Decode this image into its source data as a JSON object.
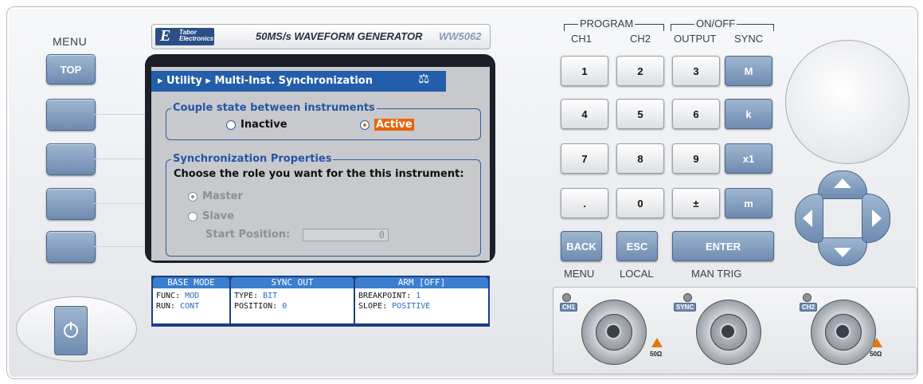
{
  "menu": {
    "label": "MENU",
    "top_button": "TOP"
  },
  "header": {
    "brand_short": "Tabor",
    "brand_line2": "Electronics",
    "title": "50MS/s WAVEFORM GENERATOR",
    "model": "WW5062"
  },
  "screen": {
    "breadcrumb": "▸ Utility ▸ Multi-Inst. Synchronization",
    "couple_group": {
      "title": "Couple state between instruments",
      "inactive": "Inactive",
      "active": "Active"
    },
    "sync_group": {
      "title": "Synchronization Properties",
      "prompt": "Choose the role you want for the this instrument:",
      "master": "Master",
      "slave": "Slave",
      "start_position_label": "Start Position:",
      "start_position_value": "0"
    }
  },
  "status": {
    "base_mode": {
      "header": "BASE MODE",
      "func_label": "FUNC:",
      "func_value": "MOD",
      "run_label": "RUN:",
      "run_value": "CONT"
    },
    "sync_out": {
      "header": "SYNC OUT",
      "type_label": "TYPE:",
      "type_value": "BIT",
      "pos_label": "POSITION:",
      "pos_value": "0"
    },
    "arm": {
      "header": "ARM [OFF]",
      "bp_label": "BREAKPOINT:",
      "bp_value": "1",
      "slope_label": "SLOPE:",
      "slope_value": "POSITIVE"
    }
  },
  "keypad": {
    "program_label": "PROGRAM",
    "ch1": "CH1",
    "ch2": "CH2",
    "onoff_label": "ON/OFF",
    "output": "OUTPUT",
    "sync": "SYNC",
    "keys": [
      "1",
      "2",
      "3",
      "M",
      "4",
      "5",
      "6",
      "k",
      "7",
      "8",
      "9",
      "x1",
      ".",
      "0",
      "±",
      "m"
    ],
    "back": "BACK",
    "esc": "ESC",
    "enter": "ENTER",
    "menu_sub": "MENU",
    "local_sub": "LOCAL",
    "mantrig_sub": "MAN TRIG"
  },
  "connectors": {
    "ch1": "CH1",
    "sync": "SYNC",
    "ch2": "CH2",
    "impedance": "50Ω"
  },
  "colors": {
    "lcd_title": "#245eaa",
    "highlight": "#e8650d",
    "button_blue": "#7b96b8"
  }
}
